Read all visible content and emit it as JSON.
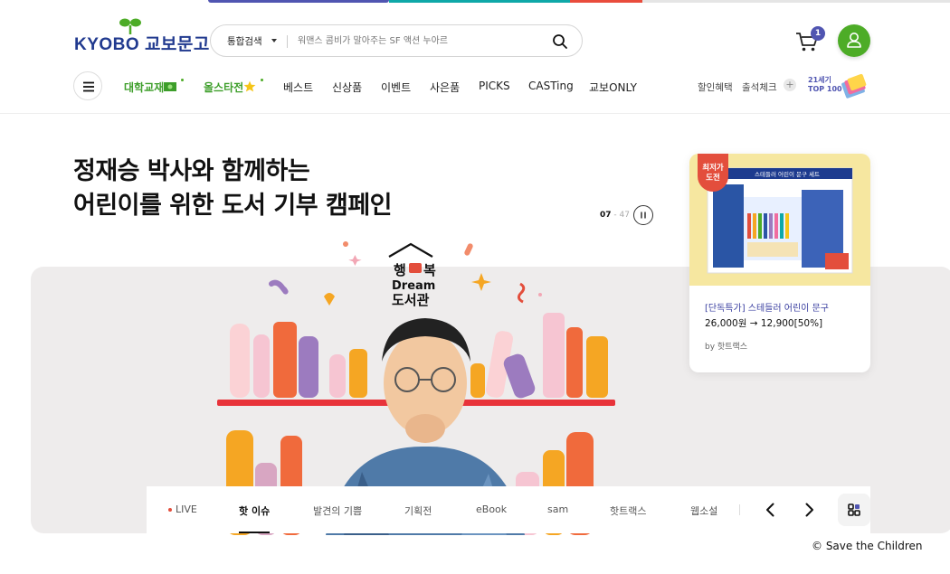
{
  "header": {
    "logo_text": "KYOBO 교보문고",
    "search": {
      "category": "통합검색",
      "placeholder": "워맨스 콤비가 말아주는 SF 액션 누아르"
    },
    "cart_count": "1",
    "icons": [
      "cart-icon",
      "user-icon",
      "search-icon",
      "menu-icon"
    ]
  },
  "nav": {
    "items": [
      {
        "label": "대학교재"
      },
      {
        "label": "올스타전"
      },
      {
        "label": "베스트"
      },
      {
        "label": "신상품"
      },
      {
        "label": "이벤트"
      },
      {
        "label": "사은품"
      },
      {
        "label": "PICKS"
      },
      {
        "label": "CASTing"
      },
      {
        "label": "교보ONLY"
      }
    ],
    "right": {
      "discount": "할인혜택",
      "attendance": "출석체크",
      "top100_line1": "21세기",
      "top100_line2": "TOP 100"
    }
  },
  "hero": {
    "title_line1": "정재승 박사와 함께하는",
    "title_line2": "어린이를 위한 도서 기부 캠페인",
    "pager_current": "07",
    "pager_total": " - 47",
    "illus_logo_line1": "행",
    "illus_logo_mid": "복",
    "illus_logo_line2": "Dream",
    "illus_logo_line3": "도서관"
  },
  "product": {
    "badge_line1": "최저가",
    "badge_line2": "도전",
    "box_title": "스테들러 어린이 문구 세트",
    "name": "[단독특가] 스테들러 어린이 문구",
    "price": "26,000원 → 12,900[50%]",
    "by": "by 핫트랙스"
  },
  "tabs": {
    "items": [
      {
        "label": "LIVE"
      },
      {
        "label": "핫 이슈"
      },
      {
        "label": "발견의 기쁨"
      },
      {
        "label": "기획전"
      },
      {
        "label": "eBook"
      },
      {
        "label": "sam"
      },
      {
        "label": "핫트랙스"
      },
      {
        "label": "웹소설"
      }
    ],
    "active_index": 1
  },
  "credit": "© Save the Children",
  "colors": {
    "brand_blue": "#213a8f",
    "brand_green": "#4dac27",
    "accent_purple": "#5055b1",
    "sale_red": "#e34e3c"
  }
}
